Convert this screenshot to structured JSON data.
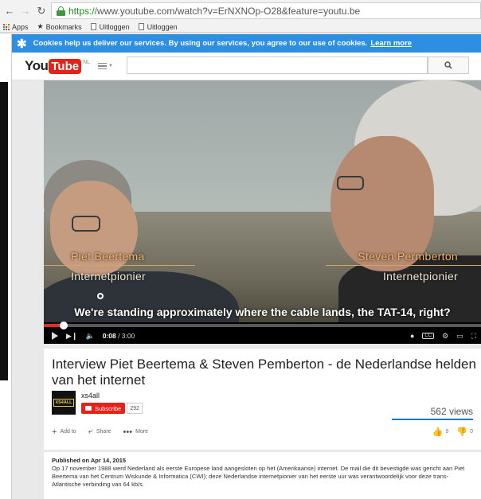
{
  "browser": {
    "url_https": "https://",
    "url_rest": "www.youtube.com/watch?v=ErNXNOp-O28&feature=youtu.be",
    "bookmarks": [
      "Apps",
      "Bookmarks",
      "Uitloggen",
      "Uitloggen"
    ]
  },
  "cookie_bar": {
    "text": "Cookies help us deliver our services. By using our services, you agree to our use of cookies.",
    "link": "Learn more"
  },
  "header": {
    "logo_you": "You",
    "logo_tube": "Tube",
    "logo_region": "NL",
    "search_placeholder": ""
  },
  "video": {
    "left_name": "Piet Beertema",
    "left_role": "Internetpionier",
    "right_name": "Steven Permberton",
    "right_role": "Internetpionier",
    "caption": "We're standing approximately where the cable lands, the TAT-14, right?",
    "time_current": "0:08",
    "time_total": "/ 3:00",
    "progress": 0.045,
    "cc": "CC"
  },
  "meta": {
    "title": "Interview Piet Beertema & Steven Pemberton - de Nederlandse helden van het internet",
    "channel_logo_text": "XS4ALL",
    "channel": "xs4all",
    "subscribe": "Subscribe",
    "subscriber_count": "292",
    "views": "562 views",
    "add_to": "Add to",
    "share": "Share",
    "more": "More",
    "likes": "9",
    "dislikes": "0"
  },
  "description": {
    "published": "Published on Apr 14, 2015",
    "text": "Op 17 november 1988 werd Nederland als eerste Europese land aangesloten op het (Amerikaanse) internet. De mail die dit bevestigde was gericht aan Piet Beertema van het Centrum Wiskunde & Informatica (CWI); deze Nederlandse internetpionier van het eerste uur was verantwoordelijk voor deze trans-Atlantische verbinding van 64 kb/s."
  },
  "colors": {
    "youtube_red": "#e62117",
    "cookie_blue": "#2d8fe2",
    "link_blue": "#167ac6"
  }
}
